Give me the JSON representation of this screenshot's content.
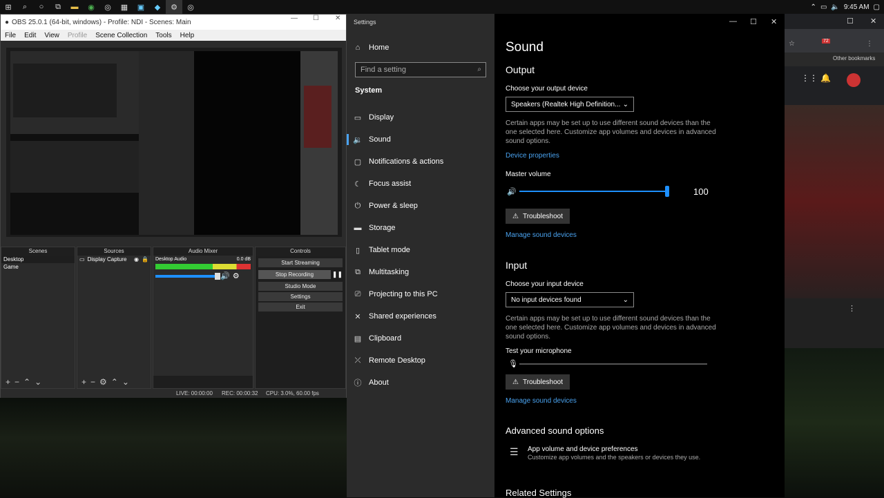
{
  "taskbar": {
    "icons": [
      "windows-icon",
      "search-icon",
      "cortana-icon",
      "taskview-icon",
      "explorer-icon",
      "chrome-icon",
      "obs-icon",
      "calculator-icon",
      "notes-icon",
      "app-icon",
      "settings-icon",
      "obs2-icon"
    ],
    "clock": "9:45 AM"
  },
  "obs": {
    "title": "OBS 25.0.1 (64-bit, windows) - Profile: NDI - Scenes: Main",
    "menu": [
      "File",
      "Edit",
      "View",
      "Profile",
      "Scene Collection",
      "Tools",
      "Help"
    ],
    "docks": {
      "scenes": {
        "title": "Scenes",
        "items": [
          "Desktop",
          "Game"
        ]
      },
      "sources": {
        "title": "Sources",
        "items": [
          "Display Capture"
        ]
      },
      "mixer": {
        "title": "Audio Mixer",
        "channel": "Desktop Audio",
        "db": "0.0 dB"
      },
      "controls": {
        "title": "Controls",
        "buttons": [
          "Start Streaming",
          "Stop Recording",
          "Studio Mode",
          "Settings",
          "Exit"
        ]
      }
    },
    "status": {
      "live": "LIVE: 00:00:00",
      "rec": "REC: 00:00:32",
      "cpu": "CPU: 3.0%, 60.00 fps"
    }
  },
  "settings": {
    "window_title": "Settings",
    "search_placeholder": "Find a setting",
    "nav": {
      "home": "Home",
      "section": "System",
      "items": [
        "Display",
        "Sound",
        "Notifications & actions",
        "Focus assist",
        "Power & sleep",
        "Storage",
        "Tablet mode",
        "Multitasking",
        "Projecting to this PC",
        "Shared experiences",
        "Clipboard",
        "Remote Desktop",
        "About"
      ],
      "selected": "Sound"
    },
    "content": {
      "title": "Sound",
      "output": {
        "heading": "Output",
        "device_label": "Choose your output device",
        "device_value": "Speakers (Realtek High Definition...",
        "desc": "Certain apps may be set up to use different sound devices than the one selected here. Customize app volumes and devices in advanced sound options.",
        "properties_link": "Device properties",
        "volume_label": "Master volume",
        "volume_value": "100",
        "troubleshoot": "Troubleshoot",
        "manage_link": "Manage sound devices"
      },
      "input": {
        "heading": "Input",
        "device_label": "Choose your input device",
        "device_value": "No input devices found",
        "desc": "Certain apps may be set up to use different sound devices than the one selected here. Customize app volumes and devices in advanced sound options.",
        "mic_label": "Test your microphone",
        "troubleshoot": "Troubleshoot",
        "manage_link": "Manage sound devices"
      },
      "advanced": {
        "heading": "Advanced sound options",
        "pref_title": "App volume and device preferences",
        "pref_desc": "Customize app volumes and the speakers or devices they use."
      },
      "related": "Related Settings"
    }
  },
  "browser": {
    "bookmarks": "Other bookmarks",
    "badge": "72"
  },
  "colors": {
    "accent": "#4aa3f0",
    "nav_bg": "#2b2b2b",
    "slider": "#1e90ff"
  }
}
